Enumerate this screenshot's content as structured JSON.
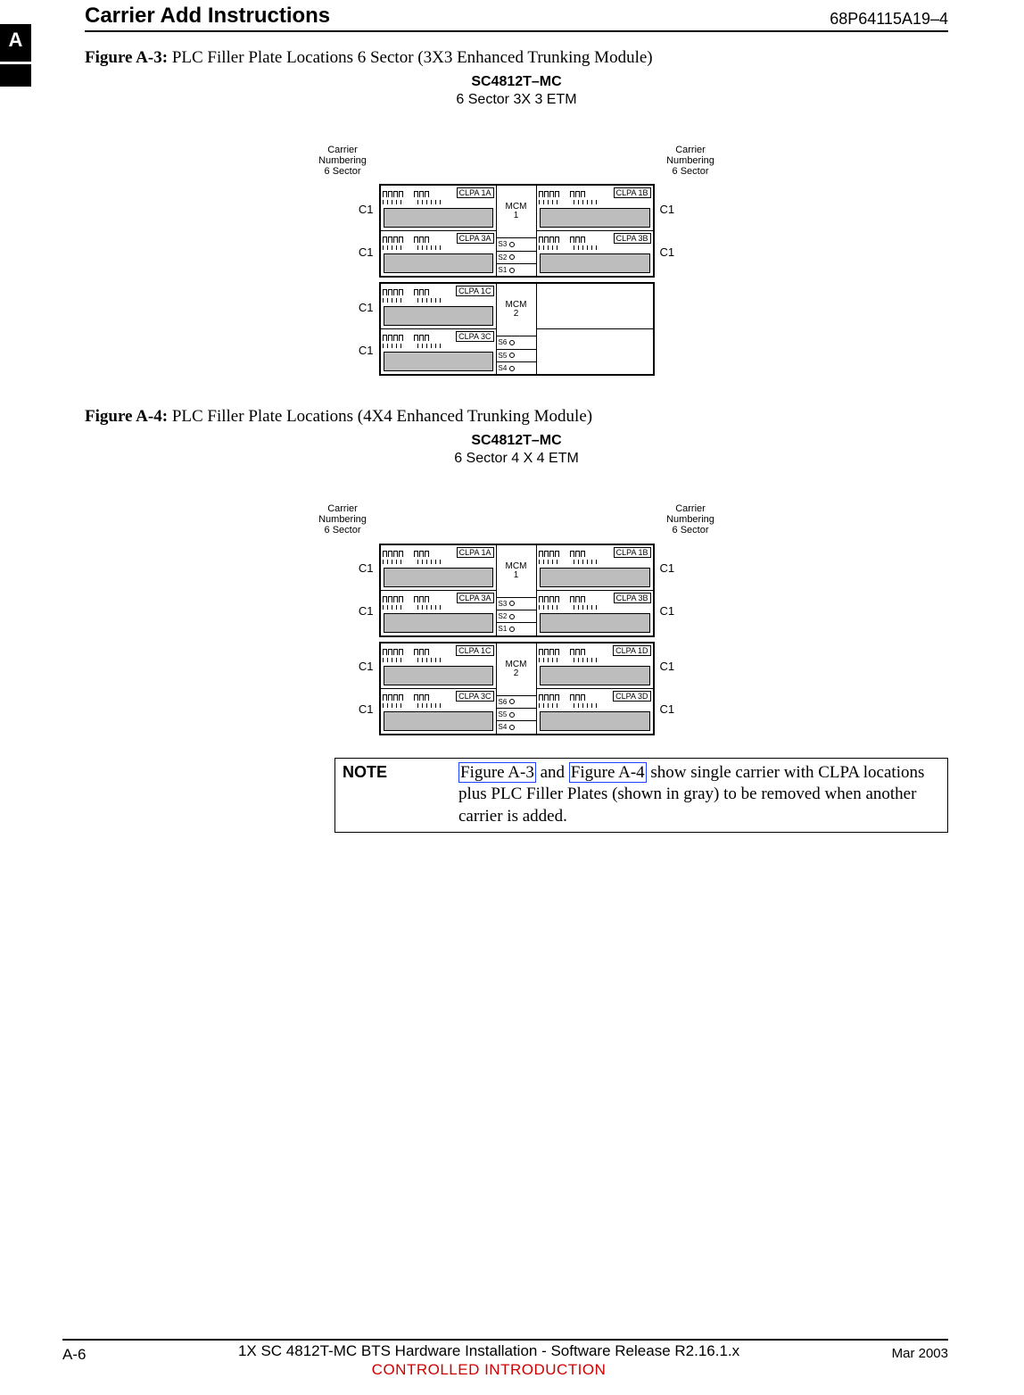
{
  "header": {
    "title": "Carrier Add Instructions",
    "docnum": "68P64115A19–4",
    "tab": "A"
  },
  "figA3": {
    "caption_label": "Figure A-3:",
    "caption_text": " PLC Filler Plate Locations 6 Sector (3X3 Enhanced Trunking Module)",
    "title_bold": "SC4812T–MC",
    "title_sub": "6 Sector 3X 3 ETM"
  },
  "figA4": {
    "caption_label": "Figure A-4:",
    "caption_text": " PLC Filler Plate Locations (4X4 Enhanced Trunking Module)",
    "title_bold": "SC4812T–MC",
    "title_sub": "6 Sector 4 X 4 ETM"
  },
  "labels": {
    "carrier_numbering": "Carrier\nNumbering\n6 Sector",
    "c1": "C1",
    "mcm1": "MCM\n1",
    "mcm2": "MCM\n2",
    "s1": "S1",
    "s2": "S2",
    "s3": "S3",
    "s4": "S4",
    "s5": "S5",
    "s6": "S6"
  },
  "clpa": {
    "a1": "CLPA 1A",
    "a3": "CLPA  3A",
    "b1": "CLPA 1B",
    "b3": "CLPA 3B",
    "c1": "CLPA  1C",
    "c3": "CLPA   3C",
    "d1": "CLPA 1D",
    "d3": "CLPA 3D"
  },
  "note": {
    "label": "NOTE",
    "xref1": "Figure A-3",
    "mid": " and ",
    "xref2": "Figure A-4",
    "rest": " show single carrier with CLPA locations plus PLC Filler Plates (shown in gray) to be removed when another carrier is added."
  },
  "footer": {
    "page": "A-6",
    "title": "1X SC 4812T-MC BTS Hardware Installation - Software Release R2.16.1.x",
    "controlled": "CONTROLLED INTRODUCTION",
    "date": "Mar 2003"
  }
}
